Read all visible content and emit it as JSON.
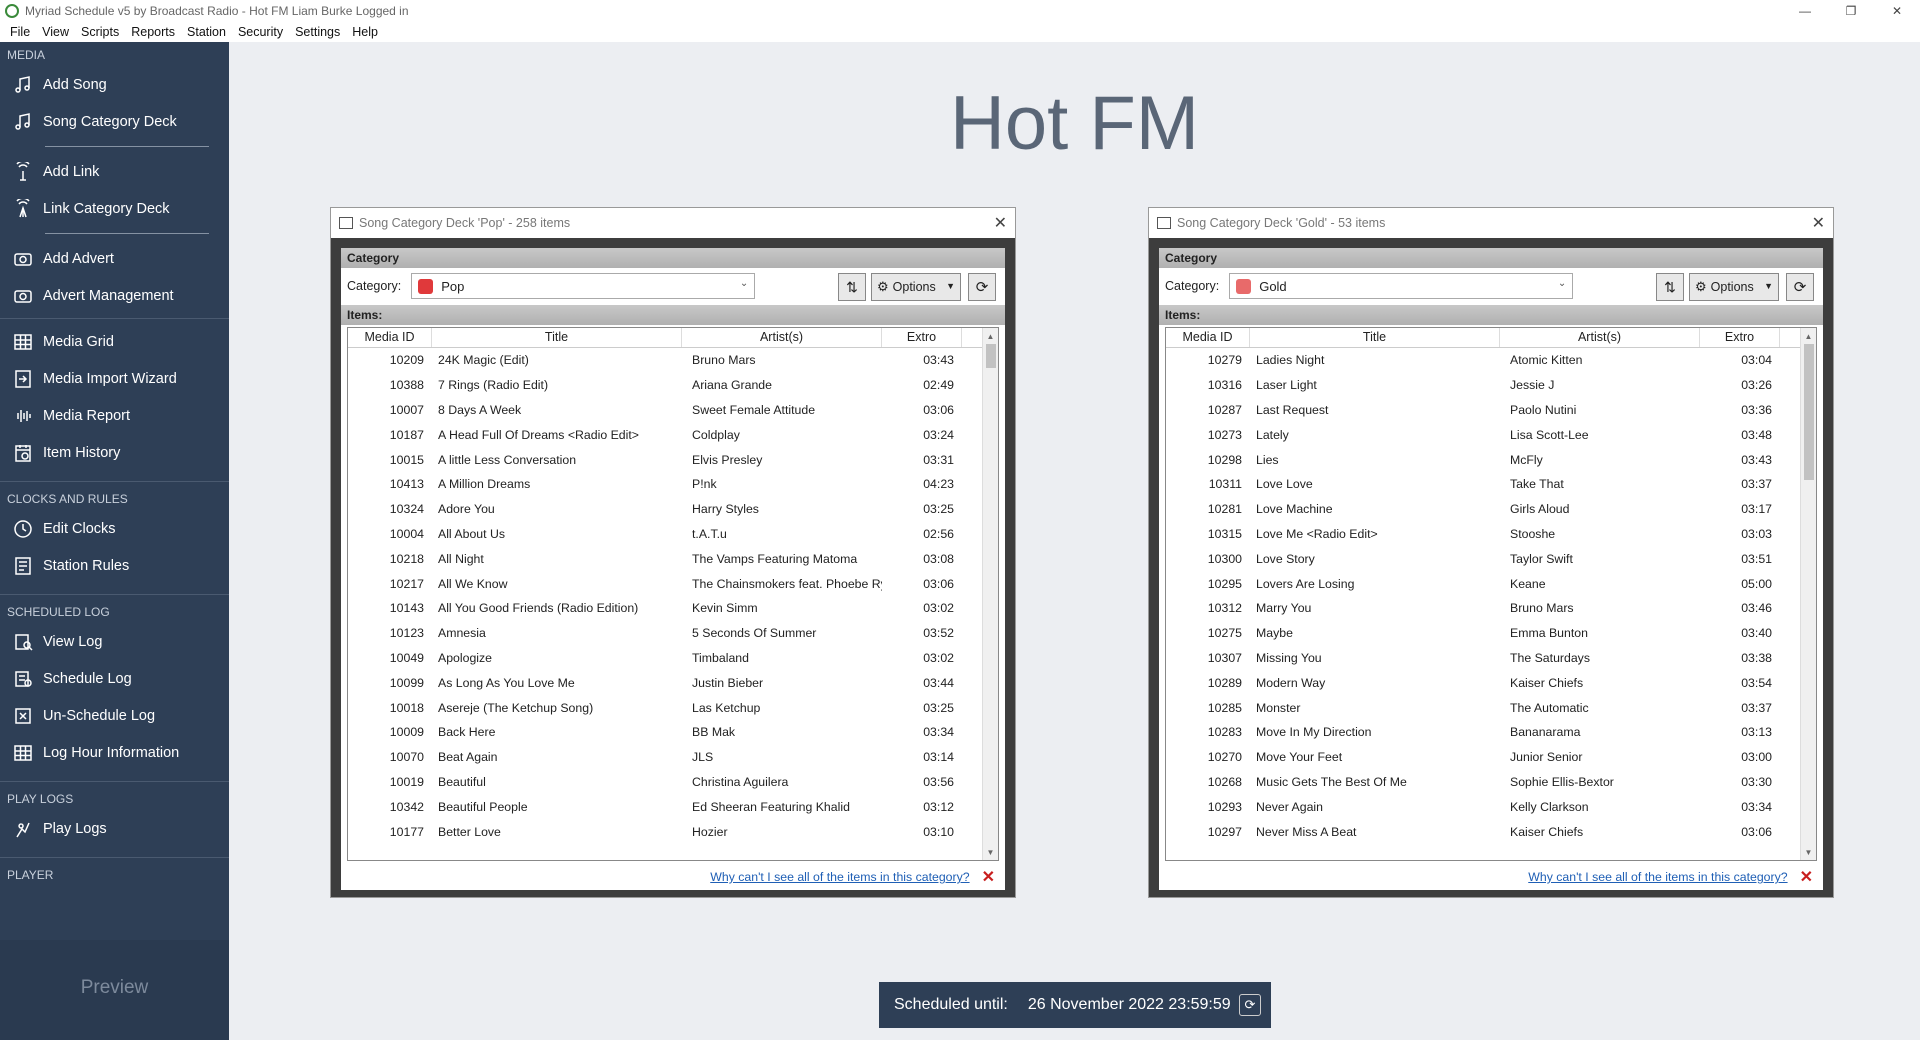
{
  "window": {
    "title": "Myriad Schedule v5 by Broadcast Radio - Hot FM Liam Burke Logged in",
    "controls": [
      "—",
      "❐",
      "✕"
    ]
  },
  "menu": [
    "File",
    "View",
    "Scripts",
    "Reports",
    "Station",
    "Security",
    "Settings",
    "Help"
  ],
  "sidebar": {
    "media_title": "MEDIA",
    "media_items": [
      {
        "label": "Add Song",
        "icon": "add-song-icon"
      },
      {
        "label": "Song Category Deck",
        "icon": "music-note-icon"
      },
      {
        "label": "Add Link",
        "icon": "add-link-icon"
      },
      {
        "label": "Link Category Deck",
        "icon": "broadcast-icon"
      },
      {
        "label": "Add Advert",
        "icon": "add-advert-icon"
      },
      {
        "label": "Advert Management",
        "icon": "advert-icon"
      },
      {
        "label": "Media Grid",
        "icon": "grid-icon"
      },
      {
        "label": "Media Import Wizard",
        "icon": "import-icon"
      },
      {
        "label": "Media Report",
        "icon": "waveform-icon"
      },
      {
        "label": "Item History",
        "icon": "history-icon"
      }
    ],
    "clocks_title": "CLOCKS AND RULES",
    "clocks_items": [
      {
        "label": "Edit Clocks",
        "icon": "clock-icon"
      },
      {
        "label": "Station Rules",
        "icon": "rules-icon"
      }
    ],
    "schedlog_title": "SCHEDULED LOG",
    "schedlog_items": [
      {
        "label": "View Log",
        "icon": "view-log-icon"
      },
      {
        "label": "Schedule Log",
        "icon": "schedule-log-icon"
      },
      {
        "label": "Un-Schedule Log",
        "icon": "unschedule-log-icon"
      },
      {
        "label": "Log Hour Information",
        "icon": "log-hour-icon"
      }
    ],
    "playlogs_title": "PLAY LOGS",
    "playlogs_items": [
      {
        "label": "Play Logs",
        "icon": "play-logs-icon"
      }
    ],
    "player_title": "PLAYER",
    "preview": "Preview"
  },
  "station_title": "Hot FM",
  "decks": [
    {
      "title": "Song Category Deck 'Pop' - 258 items",
      "category_section": "Category",
      "category_label": "Category:",
      "category_value": "Pop",
      "swatch_color": "#e0393b",
      "options_label": "Options",
      "items_section": "Items:",
      "columns": [
        "Media ID",
        "Title",
        "Artist(s)",
        "Extro"
      ],
      "rows": [
        [
          "10209",
          "24K Magic (Edit)",
          "Bruno Mars",
          "03:43"
        ],
        [
          "10388",
          "7 Rings (Radio Edit)",
          "Ariana Grande",
          "02:49"
        ],
        [
          "10007",
          "8 Days A Week",
          "Sweet Female Attitude",
          "03:06"
        ],
        [
          "10187",
          "A Head Full Of Dreams <Radio Edit>",
          "Coldplay",
          "03:24"
        ],
        [
          "10015",
          "A little Less Conversation",
          "Elvis Presley",
          "03:31"
        ],
        [
          "10413",
          "A Million Dreams",
          "P!nk",
          "04:23"
        ],
        [
          "10324",
          "Adore You",
          "Harry Styles",
          "03:25"
        ],
        [
          "10004",
          "All About Us",
          "t.A.T.u",
          "02:56"
        ],
        [
          "10218",
          "All Night",
          "The Vamps Featuring Matoma",
          "03:08"
        ],
        [
          "10217",
          "All We Know",
          "The Chainsmokers feat. Phoebe Ry",
          "03:06"
        ],
        [
          "10143",
          "All You Good Friends (Radio Edition)",
          "Kevin Simm",
          "03:02"
        ],
        [
          "10123",
          "Amnesia",
          "5 Seconds Of Summer",
          "03:52"
        ],
        [
          "10049",
          "Apologize",
          "Timbaland",
          "03:02"
        ],
        [
          "10099",
          "As Long As You Love Me",
          "Justin Bieber",
          "03:44"
        ],
        [
          "10018",
          "Asereje (The Ketchup Song)",
          "Las Ketchup",
          "03:25"
        ],
        [
          "10009",
          "Back Here",
          "BB Mak",
          "03:34"
        ],
        [
          "10070",
          "Beat Again",
          "JLS",
          "03:14"
        ],
        [
          "10019",
          "Beautiful",
          "Christina Aguilera",
          "03:56"
        ],
        [
          "10342",
          "Beautiful People",
          "Ed Sheeran Featuring Khalid",
          "03:12"
        ],
        [
          "10177",
          "Better Love",
          "Hozier",
          "03:10"
        ]
      ],
      "help_link": "Why can't I see all of the items in this category?",
      "scroll_fraction": 0.07
    },
    {
      "title": "Song Category Deck 'Gold' - 53 items",
      "category_section": "Category",
      "category_label": "Category:",
      "category_value": "Gold",
      "swatch_color": "#e86a6a",
      "options_label": "Options",
      "items_section": "Items:",
      "columns": [
        "Media ID",
        "Title",
        "Artist(s)",
        "Extro"
      ],
      "rows": [
        [
          "10279",
          "Ladies Night",
          "Atomic Kitten",
          "03:04"
        ],
        [
          "10316",
          "Laser Light",
          "Jessie J",
          "03:26"
        ],
        [
          "10287",
          "Last Request",
          "Paolo Nutini",
          "03:36"
        ],
        [
          "10273",
          "Lately",
          "Lisa Scott-Lee",
          "03:48"
        ],
        [
          "10298",
          "Lies",
          "McFly",
          "03:43"
        ],
        [
          "10311",
          "Love Love",
          "Take That",
          "03:37"
        ],
        [
          "10281",
          "Love Machine",
          "Girls Aloud",
          "03:17"
        ],
        [
          "10315",
          "Love Me <Radio Edit>",
          "Stooshe",
          "03:03"
        ],
        [
          "10300",
          "Love Story",
          "Taylor Swift",
          "03:51"
        ],
        [
          "10295",
          "Lovers Are Losing",
          "Keane",
          "05:00"
        ],
        [
          "10312",
          "Marry You",
          "Bruno Mars",
          "03:46"
        ],
        [
          "10275",
          "Maybe",
          "Emma Bunton",
          "03:40"
        ],
        [
          "10307",
          "Missing You",
          "The Saturdays",
          "03:38"
        ],
        [
          "10289",
          "Modern Way",
          "Kaiser Chiefs",
          "03:54"
        ],
        [
          "10285",
          "Monster",
          "The Automatic",
          "03:37"
        ],
        [
          "10283",
          "Move In My Direction",
          "Bananarama",
          "03:13"
        ],
        [
          "10270",
          "Move Your Feet",
          "Junior Senior",
          "03:00"
        ],
        [
          "10268",
          "Music Gets The Best Of Me",
          "Sophie Ellis-Bextor",
          "03:30"
        ],
        [
          "10293",
          "Never Again",
          "Kelly Clarkson",
          "03:34"
        ],
        [
          "10297",
          "Never Miss A Beat",
          "Kaiser Chiefs",
          "03:06"
        ]
      ],
      "help_link": "Why can't I see all of the items in this category?",
      "scroll_fraction": 0.35
    }
  ],
  "status": {
    "label": "Scheduled until:",
    "value": "26 November 2022 23:59:59"
  }
}
